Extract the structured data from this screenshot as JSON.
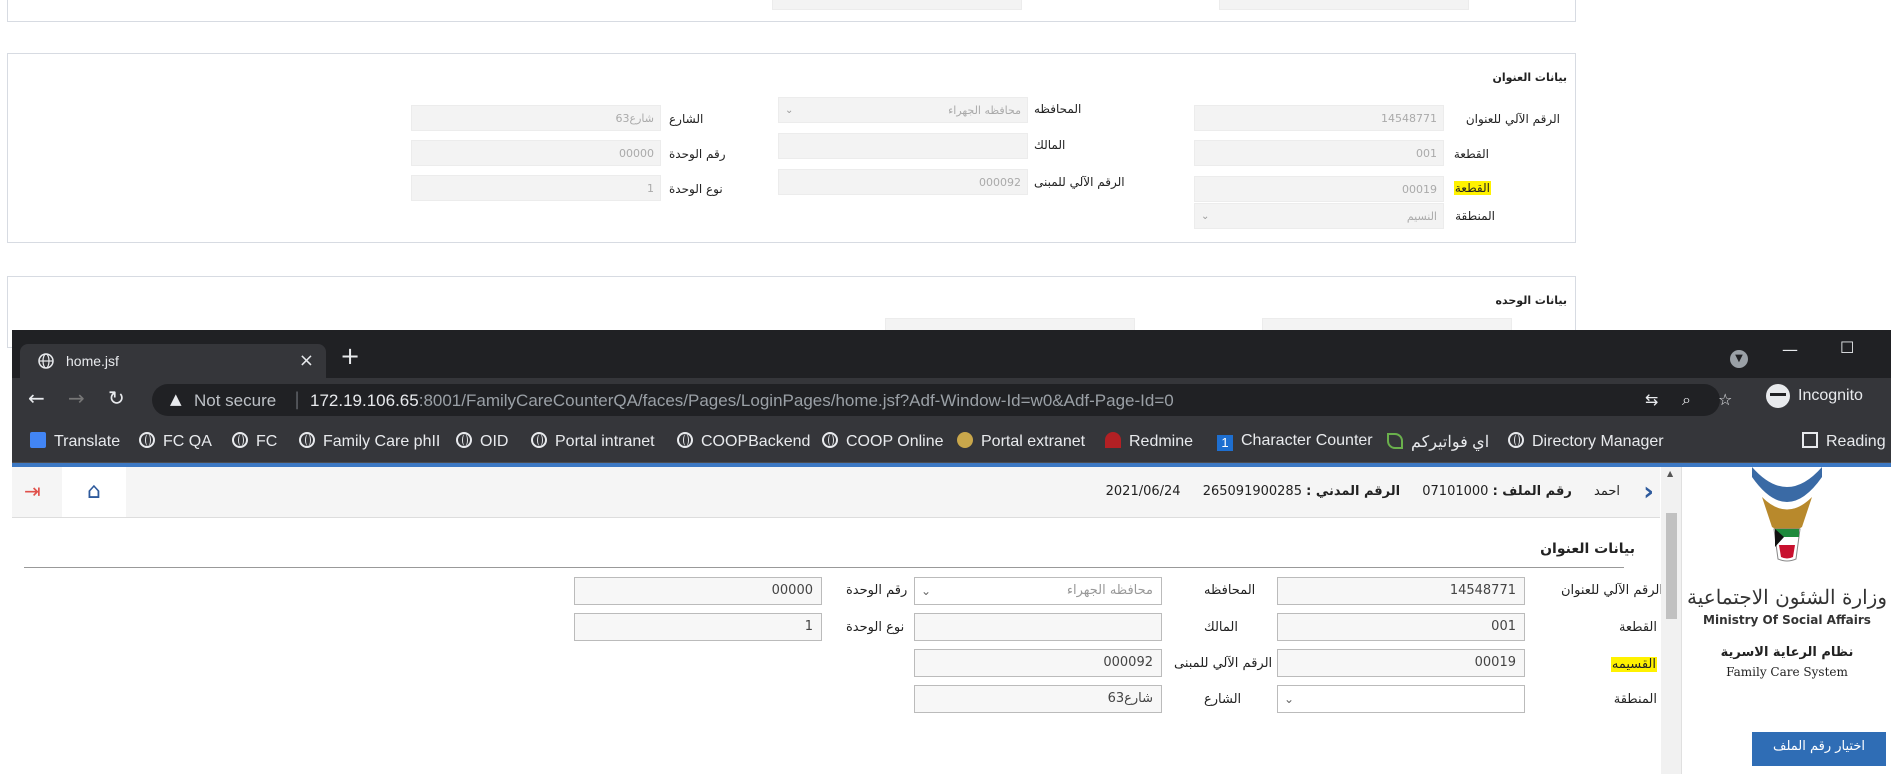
{
  "background_page": {
    "section_title": "بيانات العنوان",
    "unit_section_title": "بيانات الوحده",
    "fields": {
      "address_auto_no": {
        "label": "الرقم الآلي للعنوان",
        "value": "14548771"
      },
      "block": {
        "label": "القطعة",
        "value": "001"
      },
      "block_highlighted": {
        "label": "القطعة",
        "value": "00019"
      },
      "area": {
        "label": "المنطقة",
        "value": "النسيم"
      },
      "governorate": {
        "label": "المحافظه",
        "value": "محافظه الجهراء"
      },
      "owner": {
        "label": "المالك",
        "value": ""
      },
      "building_auto_no": {
        "label": "الرقم الآلي للمبنى",
        "value": "000092"
      },
      "street": {
        "label": "الشارع",
        "value": "شارع63"
      },
      "unit_no": {
        "label": "رقم الوحدة",
        "value": "00000"
      },
      "unit_type": {
        "label": "نوع الوحدة",
        "value": "1"
      }
    }
  },
  "browser": {
    "tab_title": "home.jsf",
    "security": "Not secure",
    "url_host": "172.19.106.65",
    "url_rest": ":8001/FamilyCareCounterQA/faces/Pages/LoginPages/home.jsf?Adf-Window-Id=w0&Adf-Page-Id=0",
    "profile": "Incognito",
    "bookmarks": [
      "Translate",
      "FC QA",
      "FC",
      "Family Care phII",
      "OID",
      "Portal intranet",
      "COOPBackend",
      "COOP Online",
      "Portal extranet",
      "Redmine",
      "Character Counter",
      "اي فواتيركم",
      "Directory Manager"
    ],
    "reading_list": "Reading"
  },
  "app": {
    "user_name": "احمد",
    "file_no_label": "رقم الملف :",
    "file_no": "07101000",
    "civil_id_label": "الرقم المدني :",
    "civil_id": "265091900285",
    "date": "2021/06/24",
    "section_title": "بيانات العنوان",
    "fields": {
      "address_auto_no": {
        "label": "الرقم الآلي للعنوان",
        "value": "14548771"
      },
      "block": {
        "label": "القطعة",
        "value": "001"
      },
      "qasima": {
        "label": "القسيمه",
        "value": "00019"
      },
      "area": {
        "label": "المنطقة",
        "value": ""
      },
      "governorate": {
        "label": "المحافظه",
        "placeholder": "محافظه الجهراء"
      },
      "owner": {
        "label": "المالك",
        "value": ""
      },
      "building_auto_no": {
        "label": "الرقم الآلي للمبنى",
        "value": "000092"
      },
      "street": {
        "label": "الشارع",
        "value": "شارع63"
      },
      "unit_no": {
        "label": "رقم الوحدة",
        "value": "00000"
      },
      "unit_type": {
        "label": "نوع الوحدة",
        "value": "1"
      }
    },
    "sidebar": {
      "ministry_ar": "وزارة الشئون الاجتماعية",
      "ministry_en": "Ministry Of Social Affairs",
      "system_ar": "نظام الرعاية الاسرية",
      "system_en": "Family Care System",
      "select_file_button": "اختيار رقم الملف"
    }
  },
  "colors": {
    "highlight": "#fff200",
    "accent_blue": "#2f6db5",
    "logout_red": "#e0504a"
  }
}
